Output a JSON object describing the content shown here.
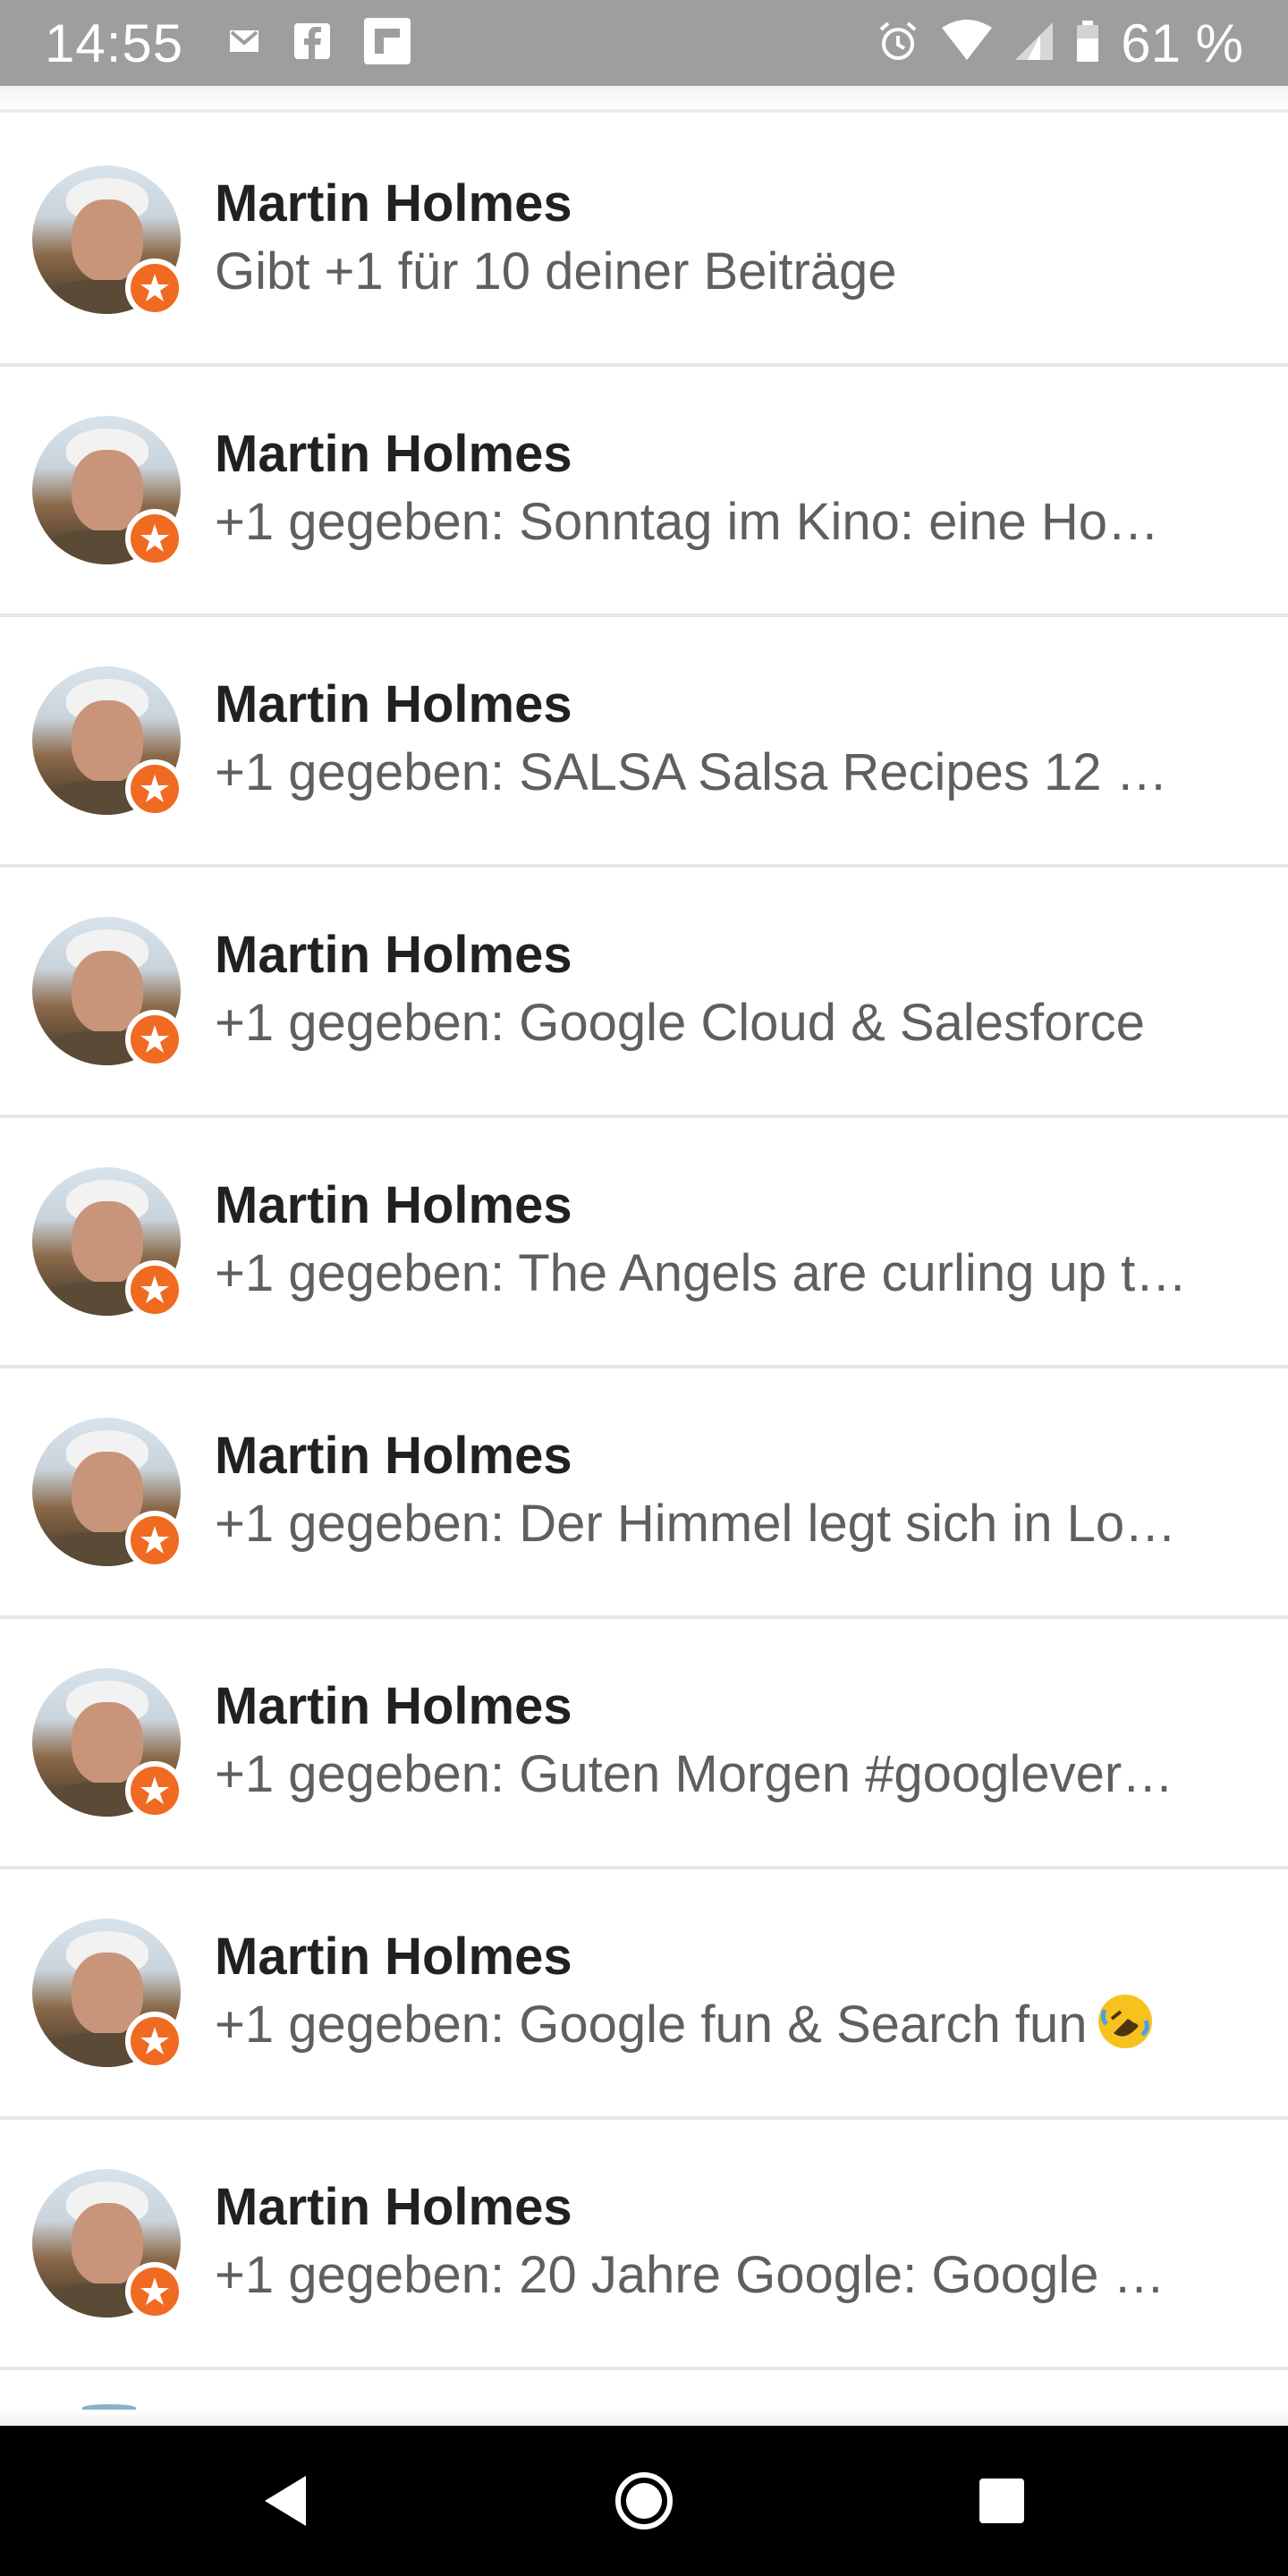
{
  "status_bar": {
    "time": "14:55",
    "battery_percent": "61 %",
    "notification_icons": [
      "gmail-icon",
      "facebook-icon",
      "flipboard-icon"
    ],
    "system_icons": [
      "alarm-icon",
      "wifi-icon",
      "signal-icon",
      "battery-icon"
    ]
  },
  "notifications": [
    {
      "name": "Martin Holmes",
      "text": "Gibt +1 für 10 deiner Beiträge"
    },
    {
      "name": "Martin Holmes",
      "text": "+1 gegeben: Sonntag im Kino: eine Ho…"
    },
    {
      "name": "Martin Holmes",
      "text": "+1 gegeben: SALSA Salsa Recipes 12 …"
    },
    {
      "name": "Martin Holmes",
      "text": "+1 gegeben: Google Cloud & Salesforce"
    },
    {
      "name": "Martin Holmes",
      "text": "+1 gegeben: The Angels are curling up t…"
    },
    {
      "name": "Martin Holmes",
      "text": "+1 gegeben: Der Himmel legt sich in Lo…"
    },
    {
      "name": "Martin Holmes",
      "text": "+1 gegeben: Guten Morgen #googlever…"
    },
    {
      "name": "Martin Holmes",
      "text": "+1 gegeben: Google fun & Search fun",
      "emoji": "rolling-on-floor-laughing-emoji"
    },
    {
      "name": "Martin Holmes",
      "text": "+1 gegeben: 20 Jahre Google: Google …"
    }
  ],
  "colors": {
    "status_bar": "#9e9e9e",
    "badge": "#f06a22",
    "name_text": "#212121",
    "sub_text": "#5f5f5f",
    "divider": "#e6e6e6",
    "nav_bar": "#000000"
  },
  "nav": [
    "back-icon",
    "home-icon",
    "recents-icon"
  ]
}
